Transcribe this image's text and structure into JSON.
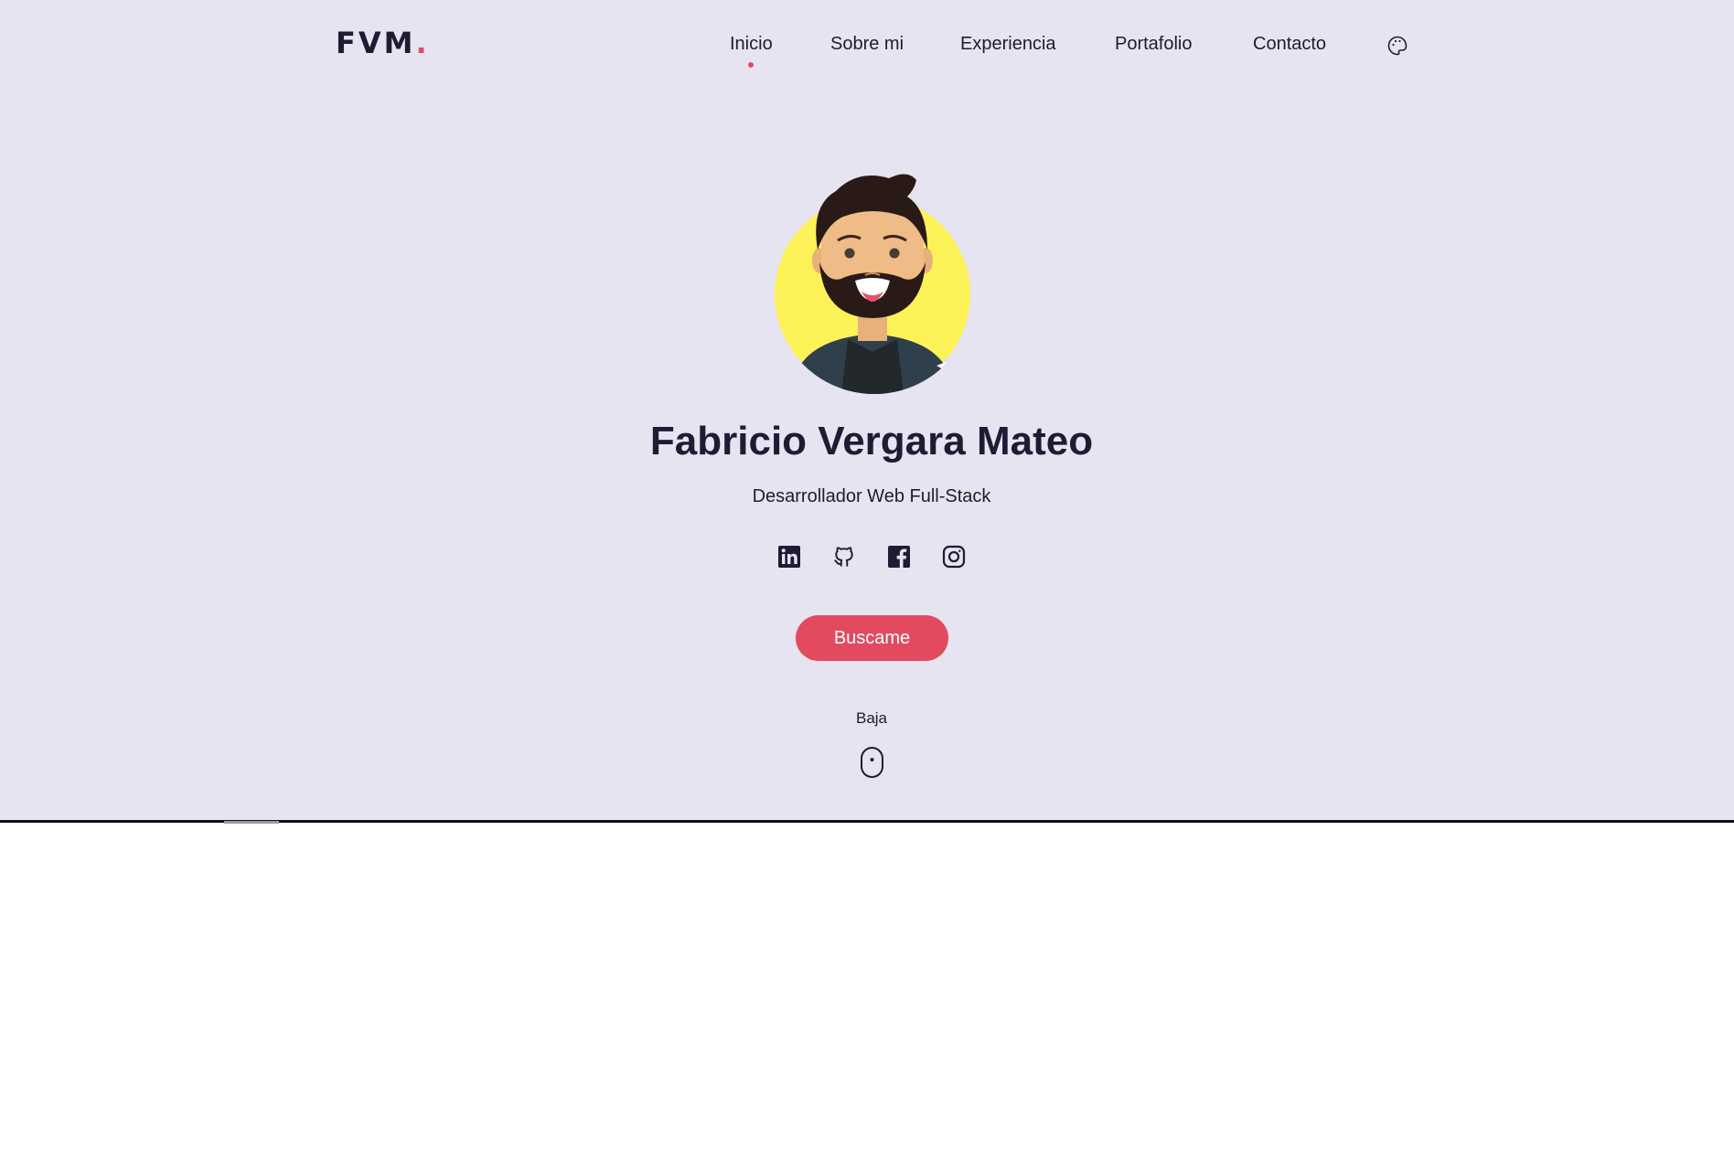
{
  "brand": {
    "name": "FVM",
    "dot": ".",
    "accent": "#e34a5f"
  },
  "nav": {
    "items": [
      {
        "label": "Inicio",
        "active": true
      },
      {
        "label": "Sobre mi"
      },
      {
        "label": "Experiencia"
      },
      {
        "label": "Portafolio"
      },
      {
        "label": "Contacto"
      }
    ],
    "theme_icon": "palette-icon"
  },
  "profile": {
    "name": "Fabricio Vergara Mateo",
    "role": "Desarrollador Web Full-Stack",
    "avatar_icon": "avatar-illustration"
  },
  "socials": [
    "linkedin-icon",
    "github-icon",
    "facebook-icon",
    "instagram-icon"
  ],
  "cta": {
    "label": "Buscame"
  },
  "scroll": {
    "label": "Baja",
    "icon": "mouse-icon"
  },
  "colors": {
    "background": "#e6e4f0",
    "text": "#1e1b34",
    "accent": "#e34a5f"
  }
}
